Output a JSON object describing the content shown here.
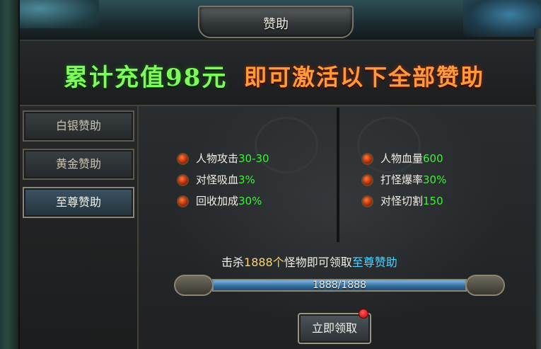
{
  "window": {
    "title": "赞助",
    "close_label": "×"
  },
  "banner": {
    "highlight": "累计充值98元",
    "message": "即可激活以下全部赞助"
  },
  "sidebar": {
    "items": [
      {
        "label": "白银赞助",
        "active": false
      },
      {
        "label": "黄金赞助",
        "active": false
      },
      {
        "label": "至尊赞助",
        "active": true
      }
    ]
  },
  "attributes": {
    "left": [
      {
        "name": "人物攻击",
        "value": "30-30"
      },
      {
        "name": "对怪吸血",
        "value": "3%"
      },
      {
        "name": "回收加成",
        "value": "30%"
      }
    ],
    "right": [
      {
        "name": "人物血量",
        "value": "600"
      },
      {
        "name": "打怪爆率",
        "value": "30%"
      },
      {
        "name": "对怪切割",
        "value": "150"
      }
    ]
  },
  "task": {
    "prefix": "击杀",
    "count": "1888",
    "unit": "个",
    "middle": "怪物即可领取",
    "tier": "至尊赞助"
  },
  "progress": {
    "text": "1888/1888",
    "fraction": 1.0
  },
  "claim_button": {
    "label": "立即领取",
    "has_notification": true
  },
  "colors": {
    "value_green": "#3ef03a",
    "count_gold": "#ffd36a",
    "tier_cyan": "#4fd2ff",
    "banner_green": "#7dfb5a",
    "banner_orange": "#ff9a3c"
  }
}
